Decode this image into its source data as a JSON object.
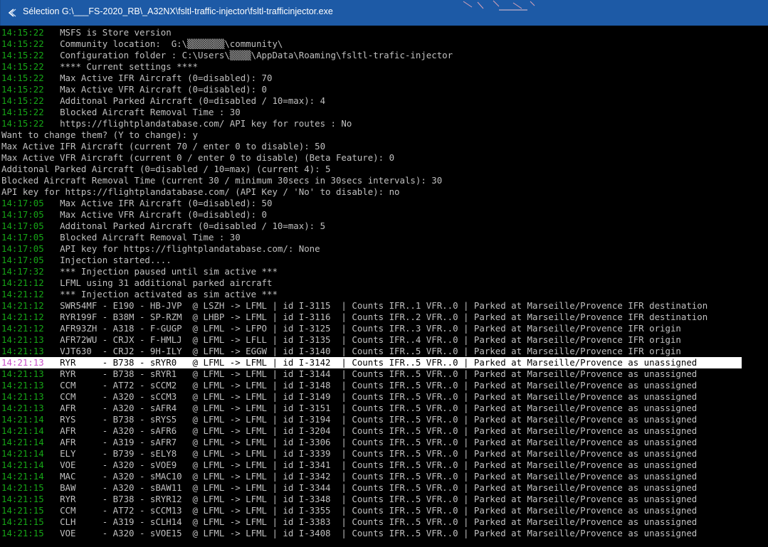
{
  "window": {
    "title": "Sélection G:\\___FS-2020_RB\\_A32NX\\fsltl-traffic-injector\\fsltl-trafficinjector.exe",
    "app_icon": "console-app-icon"
  },
  "colors": {
    "timestamp": "#16a616",
    "text": "#c0c0c0",
    "selected_timestamp": "#c94fc9",
    "selection_background": "#ffffff",
    "titlebar": "#1d5aa6"
  },
  "console": {
    "selected_line_index": 29,
    "lines": [
      {
        "ts": "14:15:22",
        "msg": "   MSFS is Store version"
      },
      {
        "ts": "14:15:22",
        "msg": "   Community location:  G:\\▒▒▒▒▒▒▒\\community\\"
      },
      {
        "ts": "14:15:22",
        "msg": "   Configuration folder : C:\\Users\\▒▒▒▒\\AppData\\Roaming\\fsltl-trafic-injector"
      },
      {
        "ts": "14:15:22",
        "msg": "   **** Current settings ****"
      },
      {
        "ts": "14:15:22",
        "msg": "   Max Active IFR Aircraft (0=disabled): 70"
      },
      {
        "ts": "14:15:22",
        "msg": "   Max Active VFR Aircraft (0=disabled): 0"
      },
      {
        "ts": "14:15:22",
        "msg": "   Additonal Parked Aircraft (0=disabled / 10=max): 4"
      },
      {
        "ts": "14:15:22",
        "msg": "   Blocked Aircraft Removal Time : 30"
      },
      {
        "ts": "14:15:22",
        "msg": "   https://flightplandatabase.com/ API key for routes : No"
      },
      {
        "ts": "",
        "msg": "Want to change them? (Y to change): y"
      },
      {
        "ts": "",
        "msg": "Max Active IFR Aircraft (current 70 / enter 0 to disable): 50"
      },
      {
        "ts": "",
        "msg": "Max Active VFR Aircraft (current 0 / enter 0 to disable) (Beta Feature): 0"
      },
      {
        "ts": "",
        "msg": "Additonal Parked Aircraft (0=disabled / 10=max) (current 4): 5"
      },
      {
        "ts": "",
        "msg": "Blocked Aircraft Removal Time (current 30 / minimum 30secs in 30secs intervals): 30"
      },
      {
        "ts": "",
        "msg": "API key for https://flightplandatabase.com/ (API Key / 'No' to disable): no"
      },
      {
        "ts": "14:17:05",
        "msg": "   Max Active IFR Aircraft (0=disabled): 50"
      },
      {
        "ts": "14:17:05",
        "msg": "   Max Active VFR Aircraft (0=disabled): 0"
      },
      {
        "ts": "14:17:05",
        "msg": "   Additonal Parked Aircraft (0=disabled / 10=max): 5"
      },
      {
        "ts": "14:17:05",
        "msg": "   Blocked Aircraft Removal Time : 30"
      },
      {
        "ts": "14:17:05",
        "msg": "   API key for https://flightplandatabase.com/: None"
      },
      {
        "ts": "14:17:05",
        "msg": "   Injection started...."
      },
      {
        "ts": "14:17:32",
        "msg": "   *** Injection paused until sim active ***"
      },
      {
        "ts": "14:21:12",
        "msg": "   LFML using 31 additional parked aircraft"
      },
      {
        "ts": "14:21:12",
        "msg": "   *** Injection activated as sim active ***"
      },
      {
        "ts": "14:21:12",
        "msg": "   SWR54MF - E190 - HB-JVP  @ LSZH -> LFML | id I-3115  | Counts IFR..1 VFR..0 | Parked at Marseille/Provence IFR destination"
      },
      {
        "ts": "14:21:12",
        "msg": "   RYR199F - B38M - SP-RZM  @ LHBP -> LFML | id I-3116  | Counts IFR..2 VFR..0 | Parked at Marseille/Provence IFR destination"
      },
      {
        "ts": "14:21:12",
        "msg": "   AFR93ZH - A318 - F-GUGP  @ LFML -> LFPO | id I-3125  | Counts IFR..3 VFR..0 | Parked at Marseille/Provence IFR origin"
      },
      {
        "ts": "14:21:13",
        "msg": "   AFR72WU - CRJX - F-HMLJ  @ LFML -> LFLL | id I-3135  | Counts IFR..4 VFR..0 | Parked at Marseille/Provence IFR origin"
      },
      {
        "ts": "14:21:13",
        "msg": "   VJT630  - CRJ2 - 9H-ILY  @ LFML -> EGGW | id I-3140  | Counts IFR..5 VFR..0 | Parked at Marseille/Provence IFR origin"
      },
      {
        "ts": "14:21:13",
        "msg": "   RYR     - B738 - sRYR0   @ LFML -> LFML | id I-3142  | Counts IFR..5 VFR..0 | Parked at Marseille/Provence as unassigned"
      },
      {
        "ts": "14:21:13",
        "msg": "   RYR     - B738 - sRYR1   @ LFML -> LFML | id I-3144  | Counts IFR..5 VFR..0 | Parked at Marseille/Provence as unassigned"
      },
      {
        "ts": "14:21:13",
        "msg": "   CCM     - AT72 - sCCM2   @ LFML -> LFML | id I-3148  | Counts IFR..5 VFR..0 | Parked at Marseille/Provence as unassigned"
      },
      {
        "ts": "14:21:13",
        "msg": "   CCM     - A320 - sCCM3   @ LFML -> LFML | id I-3149  | Counts IFR..5 VFR..0 | Parked at Marseille/Provence as unassigned"
      },
      {
        "ts": "14:21:13",
        "msg": "   AFR     - A320 - sAFR4   @ LFML -> LFML | id I-3151  | Counts IFR..5 VFR..0 | Parked at Marseille/Provence as unassigned"
      },
      {
        "ts": "14:21:14",
        "msg": "   RYS     - B738 - sRYS5   @ LFML -> LFML | id I-3194  | Counts IFR..5 VFR..0 | Parked at Marseille/Provence as unassigned"
      },
      {
        "ts": "14:21:14",
        "msg": "   AFR     - A320 - sAFR6   @ LFML -> LFML | id I-3204  | Counts IFR..5 VFR..0 | Parked at Marseille/Provence as unassigned"
      },
      {
        "ts": "14:21:14",
        "msg": "   AFR     - A319 - sAFR7   @ LFML -> LFML | id I-3306  | Counts IFR..5 VFR..0 | Parked at Marseille/Provence as unassigned"
      },
      {
        "ts": "14:21:14",
        "msg": "   ELY     - B739 - sELY8   @ LFML -> LFML | id I-3339  | Counts IFR..5 VFR..0 | Parked at Marseille/Provence as unassigned"
      },
      {
        "ts": "14:21:14",
        "msg": "   VOE     - A320 - sVOE9   @ LFML -> LFML | id I-3341  | Counts IFR..5 VFR..0 | Parked at Marseille/Provence as unassigned"
      },
      {
        "ts": "14:21:14",
        "msg": "   MAC     - A320 - sMAC10  @ LFML -> LFML | id I-3342  | Counts IFR..5 VFR..0 | Parked at Marseille/Provence as unassigned"
      },
      {
        "ts": "14:21:15",
        "msg": "   BAW     - A320 - sBAW11  @ LFML -> LFML | id I-3344  | Counts IFR..5 VFR..0 | Parked at Marseille/Provence as unassigned"
      },
      {
        "ts": "14:21:15",
        "msg": "   RYR     - B738 - sRYR12  @ LFML -> LFML | id I-3348  | Counts IFR..5 VFR..0 | Parked at Marseille/Provence as unassigned"
      },
      {
        "ts": "14:21:15",
        "msg": "   CCM     - AT72 - sCCM13  @ LFML -> LFML | id I-3355  | Counts IFR..5 VFR..0 | Parked at Marseille/Provence as unassigned"
      },
      {
        "ts": "14:21:15",
        "msg": "   CLH     - A319 - sCLH14  @ LFML -> LFML | id I-3383  | Counts IFR..5 VFR..0 | Parked at Marseille/Provence as unassigned"
      },
      {
        "ts": "14:21:15",
        "msg": "   VOE     - A320 - sVOE15  @ LFML -> LFML | id I-3408  | Counts IFR..5 VFR..0 | Parked at Marseille/Provence as unassigned"
      }
    ]
  }
}
